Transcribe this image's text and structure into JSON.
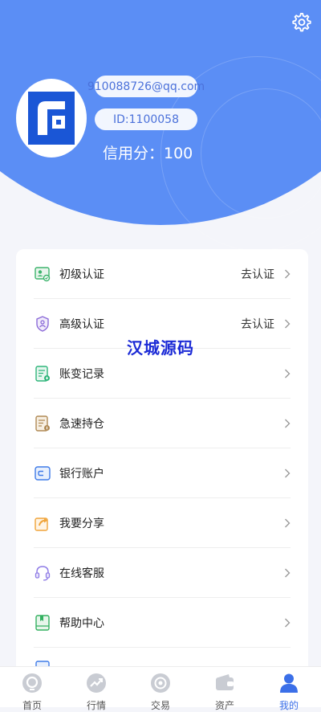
{
  "profile": {
    "email": "910088726@qq.com",
    "id_label": "ID:1100058",
    "credit_score": "信用分：100"
  },
  "watermark": "汉城源码",
  "menu": [
    {
      "label": "初级认证",
      "value": "去认证",
      "icon": "id-card-icon"
    },
    {
      "label": "高级认证",
      "value": "去认证",
      "icon": "shield-icon"
    },
    {
      "label": "账变记录",
      "value": "",
      "icon": "ledger-icon"
    },
    {
      "label": "急速持仓",
      "value": "",
      "icon": "document-icon"
    },
    {
      "label": "银行账户",
      "value": "",
      "icon": "wallet-icon"
    },
    {
      "label": "我要分享",
      "value": "",
      "icon": "share-icon"
    },
    {
      "label": "在线客服",
      "value": "",
      "icon": "headset-icon"
    },
    {
      "label": "帮助中心",
      "value": "",
      "icon": "book-icon"
    }
  ],
  "tabs": [
    {
      "label": "首页",
      "icon": "home-icon",
      "active": false
    },
    {
      "label": "行情",
      "icon": "trend-icon",
      "active": false
    },
    {
      "label": "交易",
      "icon": "exchange-icon",
      "active": false
    },
    {
      "label": "资产",
      "icon": "wallet-icon",
      "active": false
    },
    {
      "label": "我的",
      "icon": "user-icon",
      "active": true
    }
  ],
  "colors": {
    "header": "#5b8ef5",
    "accent": "#3b6fe8",
    "watermark": "#1c2bd6"
  }
}
